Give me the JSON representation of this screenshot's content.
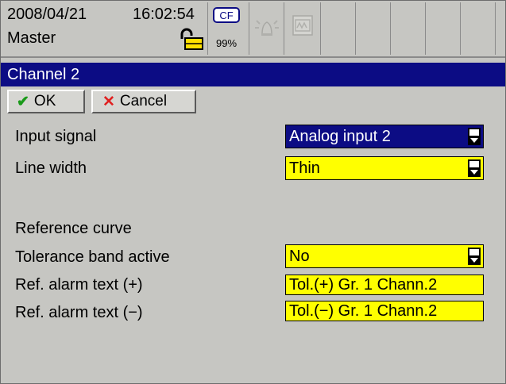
{
  "status": {
    "date": "2008/04/21",
    "time": "16:02:54",
    "user": "Master",
    "cf_label": "CF",
    "cf_usage": "99%"
  },
  "dialog": {
    "title": "Channel 2",
    "ok_label": "OK",
    "cancel_label": "Cancel"
  },
  "form": {
    "input_signal_label": "Input signal",
    "input_signal_value": "Analog input 2",
    "line_width_label": "Line width",
    "line_width_value": "Thin",
    "reference_curve_label": "Reference curve",
    "tolerance_label": "Tolerance band active",
    "tolerance_value": "No",
    "ref_alarm_plus_label": "Ref. alarm text (+)",
    "ref_alarm_plus_value": "Tol.(+) Gr. 1 Chann.2",
    "ref_alarm_minus_label": "Ref. alarm text (−)",
    "ref_alarm_minus_value": "Tol.(−) Gr. 1 Chann.2"
  },
  "colors": {
    "title_bar": "#0c0c84",
    "field_highlight": "#ffff00",
    "panel_background": "#c6c6c2"
  }
}
